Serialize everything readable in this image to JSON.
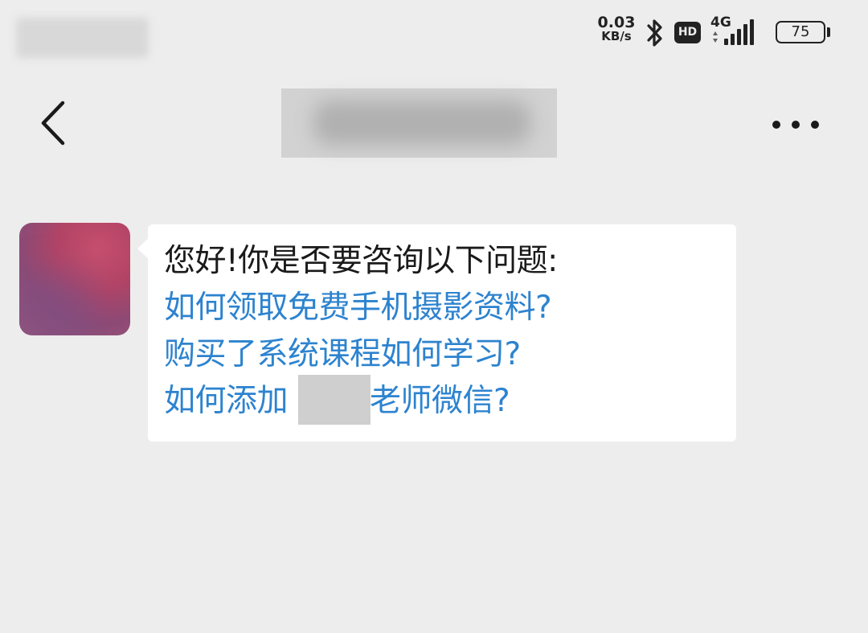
{
  "status_bar": {
    "net_speed_value": "0.03",
    "net_speed_unit": "KB/s",
    "hd_label": "HD",
    "network_type": "4G",
    "battery_level": "75",
    "icons": [
      "bluetooth-icon",
      "hd-icon",
      "signal-icon",
      "battery-icon"
    ]
  },
  "nav": {
    "back_icon": "chevron-left-icon",
    "more_icon": "more-dots-icon"
  },
  "chat": {
    "greeting": "您好!你是否要咨询以下问题:",
    "questions": [
      "如何领取免费手机摄影资料?",
      "购买了系统课程如何学习?"
    ],
    "q3_before": "如何添加",
    "q3_after": "老师微信?"
  },
  "colors": {
    "background": "#ededed",
    "bubble": "#ffffff",
    "link": "#2d83cf",
    "text": "#1a1a1a"
  }
}
